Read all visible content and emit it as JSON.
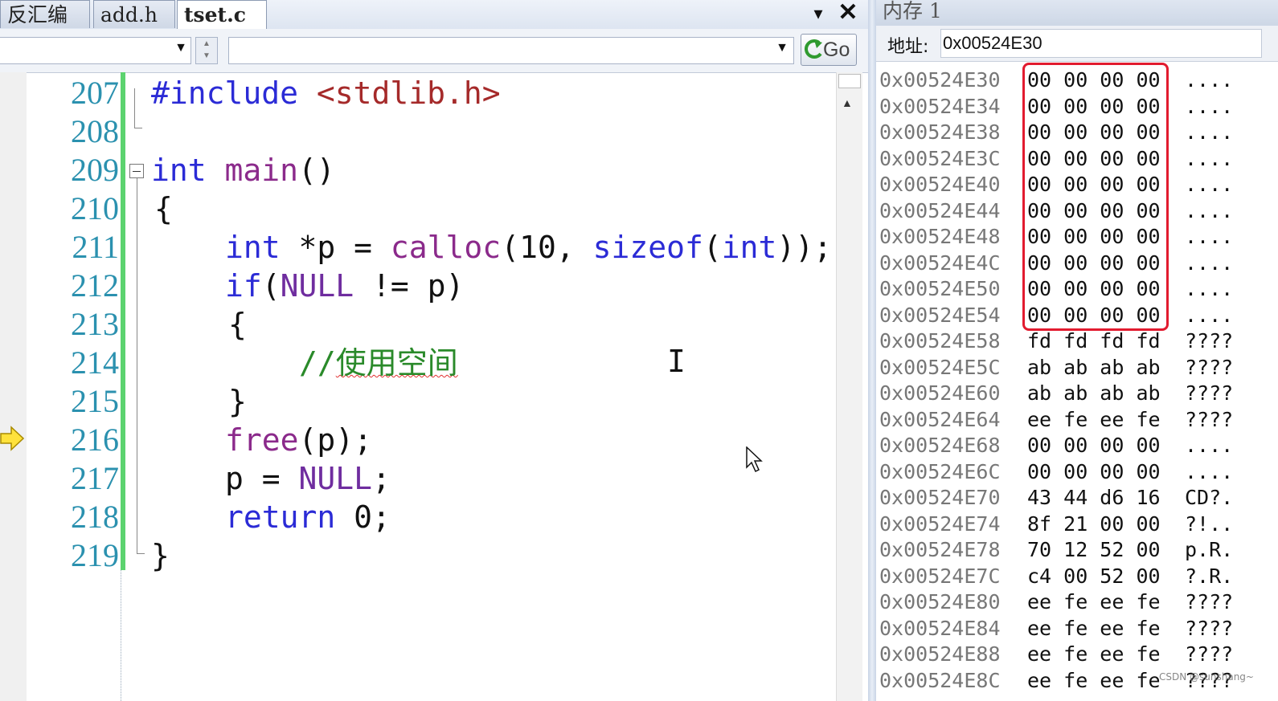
{
  "tabs": [
    {
      "label": "反汇编",
      "active": false
    },
    {
      "label": "add.h",
      "active": false
    },
    {
      "label": "tset.c",
      "active": true
    }
  ],
  "tabbar": {
    "dropdown_icon": "▾",
    "close_icon": "✕"
  },
  "navbar": {
    "scope_value": "",
    "member_value": "",
    "go_label": "Go"
  },
  "line_numbers": [
    "207",
    "208",
    "209",
    "210",
    "211",
    "212",
    "213",
    "214",
    "215",
    "216",
    "217",
    "218",
    "219"
  ],
  "code": {
    "l207": {
      "pp": "#include",
      "inc": " <stdlib.h>"
    },
    "l209": {
      "kw": "int",
      "fn": "main",
      "rest": "()"
    },
    "l210": {
      "text": "{"
    },
    "l211": {
      "kw1": "int",
      "t1": " *p = ",
      "fn1": "calloc",
      "t2": "(10, ",
      "kw2": "sizeof",
      "t3": "(",
      "kw3": "int",
      "t4": "));"
    },
    "l212": {
      "kw": "if",
      "t1": "(",
      "mac": "NULL",
      "t2": " != p)"
    },
    "l213": {
      "text": "{"
    },
    "l214": {
      "slashes": "//",
      "comment": "使用空间"
    },
    "l215": {
      "text": "}"
    },
    "l216": {
      "fn": "free",
      "rest": "(p);"
    },
    "l217": {
      "t1": "p = ",
      "mac": "NULL",
      "t2": ";"
    },
    "l218": {
      "kw": "return",
      "rest": " 0;"
    },
    "l219": {
      "text": "}"
    }
  },
  "current_line": "216",
  "memory": {
    "title": "内存 1",
    "address_label": "地址:",
    "address_value": "0x00524E30",
    "rows": [
      {
        "addr": "0x00524E30",
        "bytes": "00 00 00 00",
        "ascii": "...."
      },
      {
        "addr": "0x00524E34",
        "bytes": "00 00 00 00",
        "ascii": "...."
      },
      {
        "addr": "0x00524E38",
        "bytes": "00 00 00 00",
        "ascii": "...."
      },
      {
        "addr": "0x00524E3C",
        "bytes": "00 00 00 00",
        "ascii": "...."
      },
      {
        "addr": "0x00524E40",
        "bytes": "00 00 00 00",
        "ascii": "...."
      },
      {
        "addr": "0x00524E44",
        "bytes": "00 00 00 00",
        "ascii": "...."
      },
      {
        "addr": "0x00524E48",
        "bytes": "00 00 00 00",
        "ascii": "...."
      },
      {
        "addr": "0x00524E4C",
        "bytes": "00 00 00 00",
        "ascii": "...."
      },
      {
        "addr": "0x00524E50",
        "bytes": "00 00 00 00",
        "ascii": "...."
      },
      {
        "addr": "0x00524E54",
        "bytes": "00 00 00 00",
        "ascii": "...."
      },
      {
        "addr": "0x00524E58",
        "bytes": "fd fd fd fd",
        "ascii": "????"
      },
      {
        "addr": "0x00524E5C",
        "bytes": "ab ab ab ab",
        "ascii": "????"
      },
      {
        "addr": "0x00524E60",
        "bytes": "ab ab ab ab",
        "ascii": "????"
      },
      {
        "addr": "0x00524E64",
        "bytes": "ee fe ee fe",
        "ascii": "????"
      },
      {
        "addr": "0x00524E68",
        "bytes": "00 00 00 00",
        "ascii": "...."
      },
      {
        "addr": "0x00524E6C",
        "bytes": "00 00 00 00",
        "ascii": "...."
      },
      {
        "addr": "0x00524E70",
        "bytes": "43 44 d6 16",
        "ascii": "CD?."
      },
      {
        "addr": "0x00524E74",
        "bytes": "8f 21 00 00",
        "ascii": "?!.."
      },
      {
        "addr": "0x00524E78",
        "bytes": "70 12 52 00",
        "ascii": "p.R."
      },
      {
        "addr": "0x00524E7C",
        "bytes": "c4 00 52 00",
        "ascii": "?.R."
      },
      {
        "addr": "0x00524E80",
        "bytes": "ee fe ee fe",
        "ascii": "????"
      },
      {
        "addr": "0x00524E84",
        "bytes": "ee fe ee fe",
        "ascii": "????"
      },
      {
        "addr": "0x00524E88",
        "bytes": "ee fe ee fe",
        "ascii": "????"
      },
      {
        "addr": "0x00524E8C",
        "bytes": "ee fe ee fe",
        "ascii": "????"
      }
    ],
    "highlight_color": "#e21b2f"
  },
  "watermark": "CSDN @sunshang~",
  "colors": {
    "keyword": "#2b2bd6",
    "function": "#8b2a8b",
    "comment": "#2a8a2a",
    "line_number": "#2b91af",
    "change_bar": "#5cd36f"
  }
}
